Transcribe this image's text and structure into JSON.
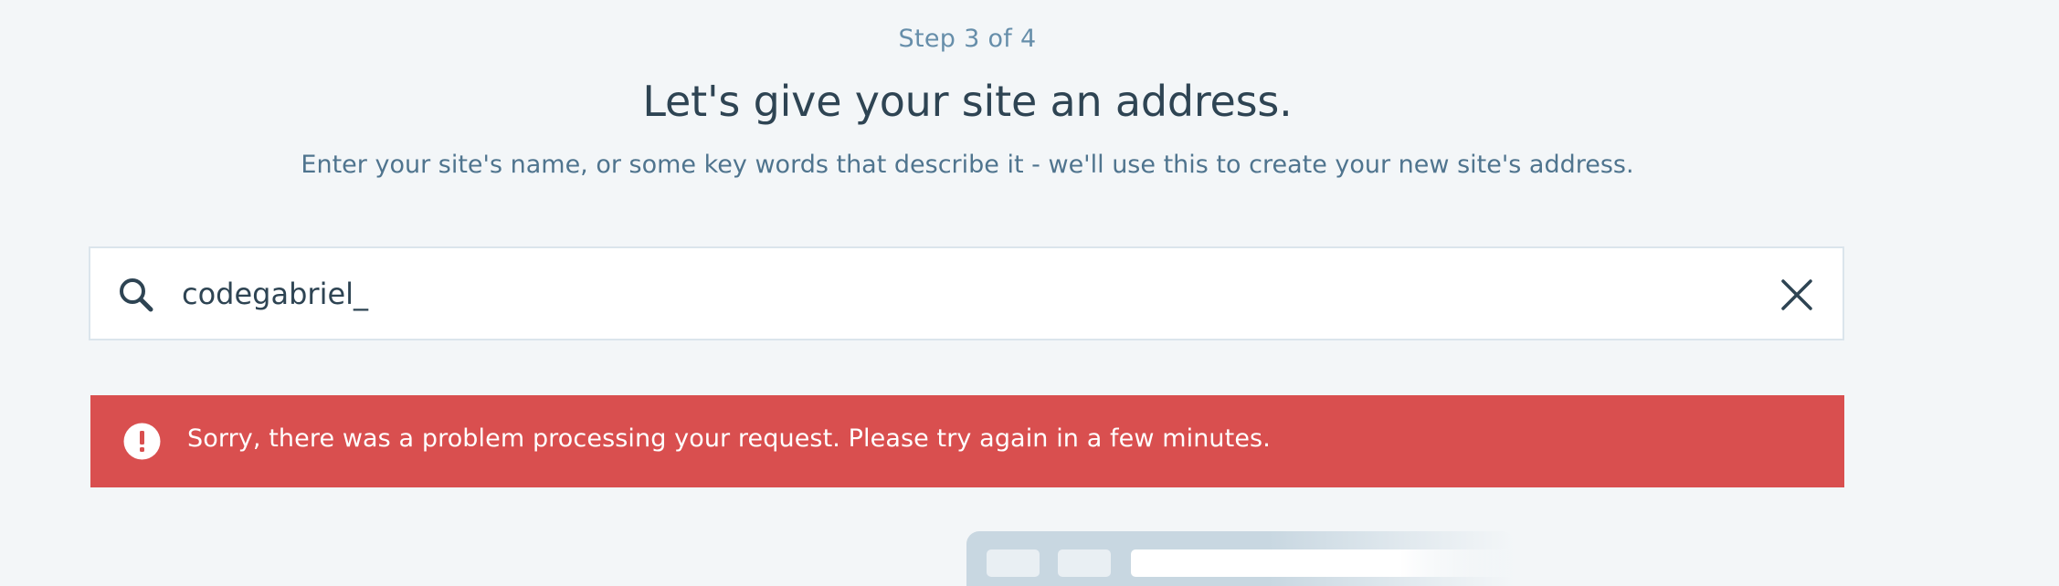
{
  "header": {
    "step": "Step 3 of 4",
    "title": "Let's give your site an address.",
    "subtitle": "Enter your site's name, or some key words that describe it - we'll use this to create your new site's address."
  },
  "search": {
    "value": "codegabriel_",
    "icon": "search-icon",
    "clear_icon": "close-icon"
  },
  "notice": {
    "status": "error",
    "icon": "notice-alert-icon",
    "text": "Sorry, there was a problem processing your request. Please try again in a few minutes.",
    "color": "#d94f4f"
  },
  "colors": {
    "background": "#f3f6f8",
    "heading": "#2e4453",
    "subtext": "#4f748e"
  }
}
